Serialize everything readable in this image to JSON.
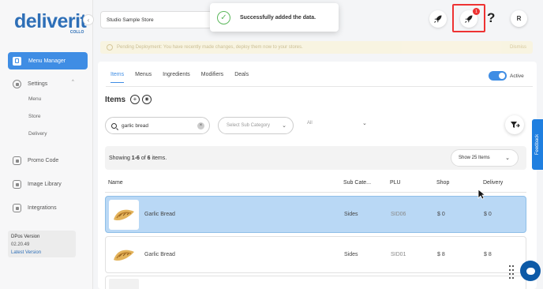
{
  "brand": {
    "name": "deliverit",
    "sub": "COLLO"
  },
  "sidebar": {
    "collapse_icon": "‹",
    "active_item": {
      "label": "Menu Manager",
      "icon": "menu-book-icon"
    },
    "settings": {
      "label": "Settings",
      "icon": "gear-icon",
      "caret": "^",
      "children": [
        {
          "label": "Menu"
        },
        {
          "label": "Store"
        },
        {
          "label": "Delivery"
        }
      ]
    },
    "items": [
      {
        "label": "Promo Code",
        "icon": "promo-icon"
      },
      {
        "label": "Image Library",
        "icon": "image-icon"
      },
      {
        "label": "Integrations",
        "icon": "integrations-icon"
      }
    ],
    "version": {
      "title": "DPos Version",
      "number": "02.20.49",
      "latest_link": "Latest Version"
    }
  },
  "header": {
    "store": "Studio Sample Store",
    "toast": {
      "message": "Successfully added the data.",
      "icon": "check-circle-icon"
    },
    "rocket_badge": "1",
    "help": "?",
    "user_initial": "R"
  },
  "banner": {
    "text": "Pending Deployment: You have recently made changes, deploy them now to your stores.",
    "dismiss": "Dismiss"
  },
  "tabs": [
    "Items",
    "Menus",
    "Ingredients",
    "Modifiers",
    "Deals"
  ],
  "active_toggle_label": "Active",
  "section": {
    "title": "Items",
    "add_icon": "+",
    "view_icon": "◉"
  },
  "filters": {
    "search_value": "garlic bread",
    "sub_category_placeholder": "Select Sub Category",
    "all_label": "All",
    "chevron": "⌄",
    "clear": "×"
  },
  "pagination": {
    "showing_prefix": "Showing ",
    "range": "1-6",
    "of_text": " of ",
    "total": "6",
    "suffix": " items.",
    "page_size": "Show 25 Items"
  },
  "table": {
    "headers": {
      "name": "Name",
      "sub_category": "Sub Cate...",
      "plu": "PLU",
      "shop": "Shop",
      "delivery": "Delivery"
    },
    "rows": [
      {
        "name": "Garlic Bread",
        "sub_category": "Sides",
        "plu": "SID06",
        "shop": "$ 0",
        "delivery": "$ 0"
      },
      {
        "name": "Garlic Bread",
        "sub_category": "Sides",
        "plu": "SID01",
        "shop": "$ 8",
        "delivery": "$ 8"
      }
    ]
  },
  "feedback_label": "Feedback",
  "colors": {
    "accent": "#3f8de4",
    "brand": "#2e6fb7",
    "selected_row": "#b9d8f5",
    "alert": "#ee3333",
    "success": "#5cb85c"
  }
}
